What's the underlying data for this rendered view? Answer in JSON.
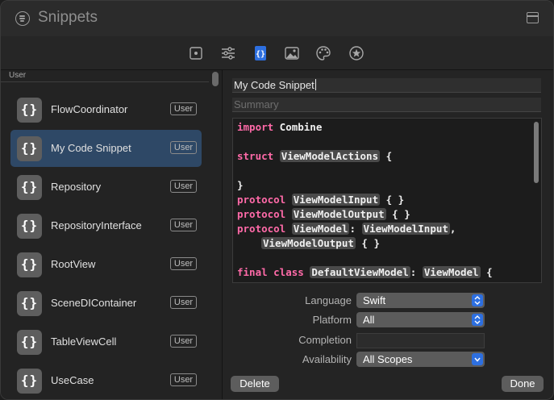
{
  "window": {
    "title": "Snippets"
  },
  "toolbar": {
    "icons": [
      "square-dot-icon",
      "sliders-icon",
      "code-braces-icon",
      "image-icon",
      "palette-icon",
      "star-icon"
    ],
    "selected_index": 2,
    "accent": "#2d6fe0"
  },
  "sidebar": {
    "header": "User",
    "items": [
      {
        "label": "FlowCoordinator",
        "badge": "User",
        "selected": false
      },
      {
        "label": "My Code Snippet",
        "badge": "User",
        "selected": true
      },
      {
        "label": "Repository",
        "badge": "User",
        "selected": false
      },
      {
        "label": "RepositoryInterface",
        "badge": "User",
        "selected": false
      },
      {
        "label": "RootView",
        "badge": "User",
        "selected": false
      },
      {
        "label": "SceneDIContainer",
        "badge": "User",
        "selected": false
      },
      {
        "label": "TableViewCell",
        "badge": "User",
        "selected": false
      },
      {
        "label": "UseCase",
        "badge": "User",
        "selected": false
      }
    ],
    "icon_glyph": "{}"
  },
  "detail": {
    "title_value": "My Code Snippet",
    "summary_placeholder": "Summary",
    "code": {
      "l1_kw": "import",
      "l1_rest": " Combine",
      "l2_kw": "struct",
      "l2_tok": "ViewModelActions",
      "l2_rest": " {",
      "l3": "}",
      "l4_kw": "protocol",
      "l4_tok": "ViewModelInput",
      "l4_rest": " { }",
      "l5_kw": "protocol",
      "l5_tok": "ViewModelOutput",
      "l5_rest": " { }",
      "l6_kw": "protocol",
      "l6_tok": "ViewModel",
      "l6_mid": ": ",
      "l6_tok2": "ViewModelInput",
      "l6_rest": ",",
      "l7_tok": "ViewModelOutput",
      "l7_rest": " { }",
      "l8_kw": "final class",
      "l8_tok": "DefaultViewModel",
      "l8_mid": ": ",
      "l8_tok2": "ViewModel",
      "l8_rest": " {"
    },
    "form": {
      "language_label": "Language",
      "language_value": "Swift",
      "platform_label": "Platform",
      "platform_value": "All",
      "completion_label": "Completion",
      "completion_value": "",
      "availability_label": "Availability",
      "availability_value": "All Scopes"
    },
    "delete_label": "Delete",
    "done_label": "Done"
  }
}
